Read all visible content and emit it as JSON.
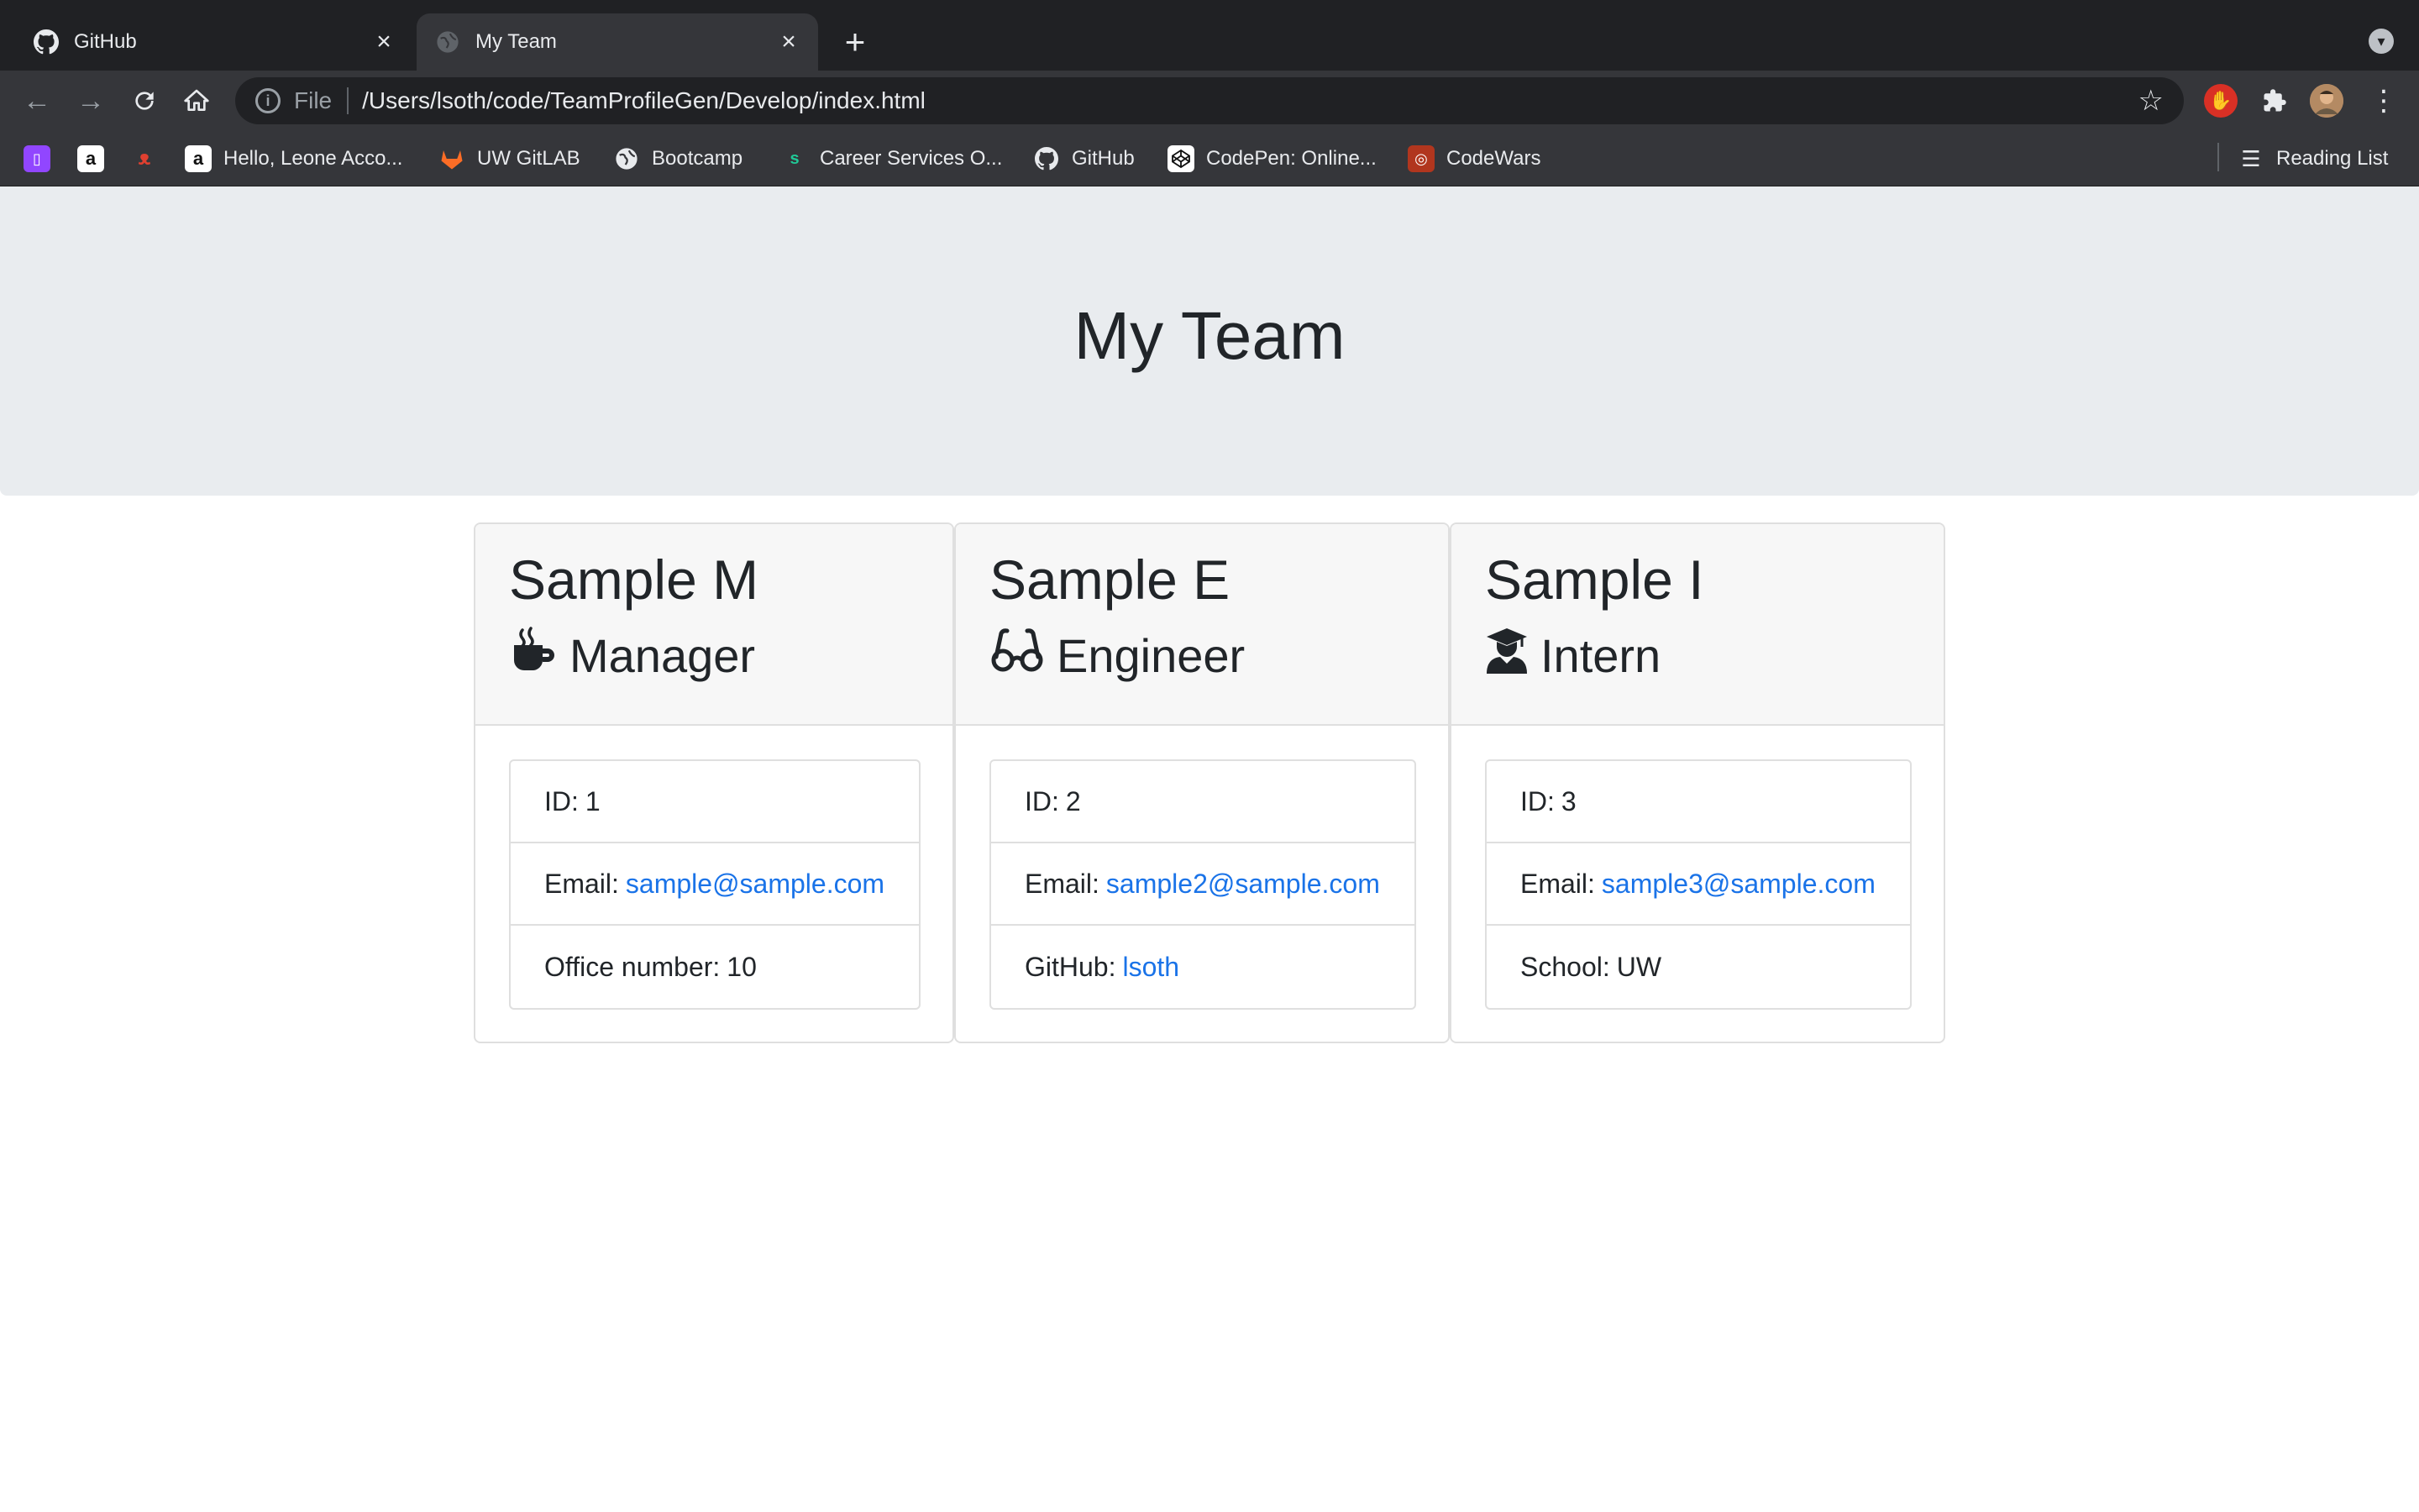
{
  "browser": {
    "tabs": [
      {
        "title": "GitHub",
        "icon": "github-icon",
        "active": false
      },
      {
        "title": "My Team",
        "icon": "globe-icon",
        "active": true
      }
    ],
    "address": {
      "scheme_label": "File",
      "url": "/Users/lsoth/code/TeamProfileGen/Develop/index.html"
    },
    "bookmarks": [
      {
        "label": "",
        "icon": "twitch-icon"
      },
      {
        "label": "",
        "icon": "amazon-icon"
      },
      {
        "label": "",
        "icon": "red-logo-icon"
      },
      {
        "label": "Hello, Leone Acco...",
        "icon": "amazon-icon"
      },
      {
        "label": "UW GitLAB",
        "icon": "gitlab-icon"
      },
      {
        "label": "Bootcamp",
        "icon": "globe-icon"
      },
      {
        "label": "Career Services O...",
        "icon": "s-icon"
      },
      {
        "label": "GitHub",
        "icon": "github-icon"
      },
      {
        "label": "CodePen: Online...",
        "icon": "codepen-icon"
      },
      {
        "label": "CodeWars",
        "icon": "codewars-icon"
      }
    ],
    "reading_list": "Reading List"
  },
  "page": {
    "title": "My Team",
    "cards": [
      {
        "name": "Sample M",
        "role": "Manager",
        "role_icon": "mug-icon",
        "id_label": "ID:",
        "id": "1",
        "email_label": "Email:",
        "email": "sample@sample.com",
        "extra_label": "Office number:",
        "extra": "10"
      },
      {
        "name": "Sample E",
        "role": "Engineer",
        "role_icon": "glasses-icon",
        "id_label": "ID:",
        "id": "2",
        "email_label": "Email:",
        "email": "sample2@sample.com",
        "extra_label": "GitHub:",
        "extra": "lsoth"
      },
      {
        "name": "Sample I",
        "role": "Intern",
        "role_icon": "graduate-icon",
        "id_label": "ID:",
        "id": "3",
        "email_label": "Email:",
        "email": "sample3@sample.com",
        "extra_label": "School:",
        "extra": "UW"
      }
    ]
  },
  "colors": {
    "link": "#1a73e8",
    "jumbotron": "#e9ecef",
    "chrome_dark": "#202124",
    "chrome_toolbar": "#35363a"
  }
}
